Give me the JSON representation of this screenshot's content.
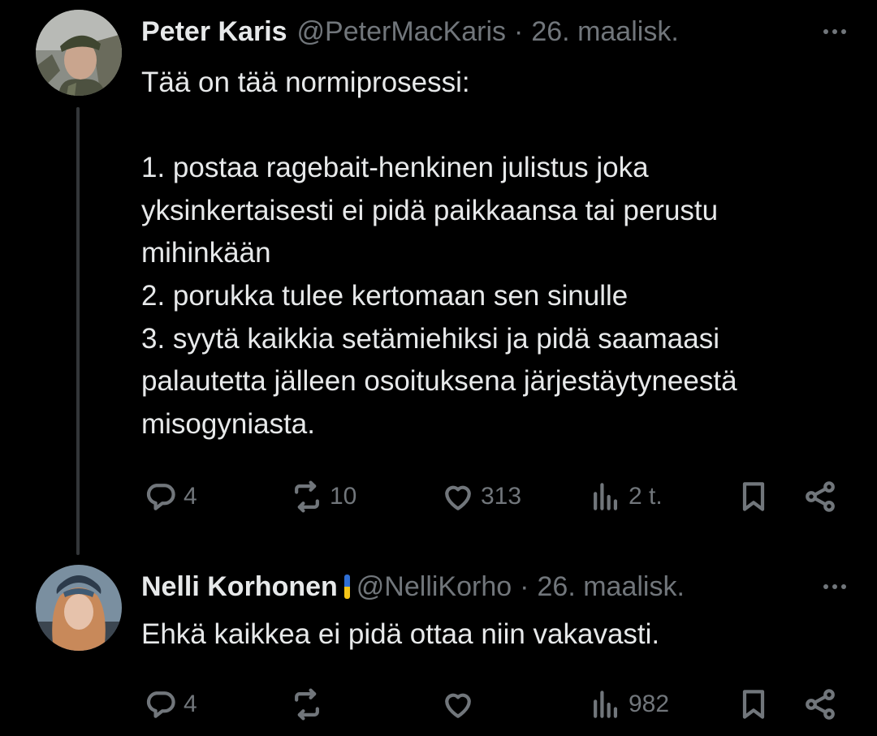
{
  "tweets": [
    {
      "name": "Peter Karis",
      "handle": "@PeterMacKaris",
      "date": "26. maalisk.",
      "text": "Tää on tää normiprosessi:\n\n1. postaa ragebait-henkinen julistus joka yksinkertaisesti ei pidä paikkaansa tai perustu mihinkään\n2. porukka tulee kertomaan sen sinulle\n3. syytä kaikkia setämiehiksi ja pidä saamaasi palautetta jälleen osoituksena järjestäytyneestä misogyniasta.",
      "replies": "4",
      "reposts": "10",
      "likes": "313",
      "views": "2 t."
    },
    {
      "name": "Nelli Korhonen",
      "handle": "@NelliKorho",
      "date": "26. maalisk.",
      "text": "Ehkä kaikkea ei pidä ottaa niin vakavasti.",
      "replies": "4",
      "reposts": "",
      "likes": "",
      "views": "982"
    }
  ],
  "icons": {
    "reply": "reply-icon",
    "repost": "repost-icon",
    "like": "heart-icon",
    "views": "views-icon",
    "bookmark": "bookmark-icon",
    "share": "share-icon",
    "more": "more-icon",
    "flag": "ukraine-flag-icon"
  },
  "colors": {
    "background": "#000000",
    "text": "#e7e9ea",
    "secondary": "#71767b",
    "thread_line": "#333639"
  }
}
